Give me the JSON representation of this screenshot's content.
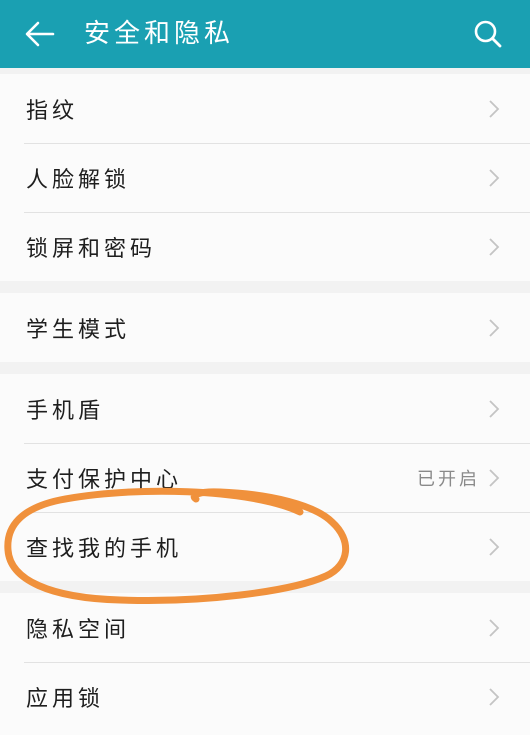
{
  "header": {
    "title": "安全和隐私",
    "back_icon": "arrow-left-icon",
    "search_icon": "search-icon",
    "bar_color": "#1aa0b2"
  },
  "groups": [
    {
      "items": [
        {
          "label": "指纹"
        },
        {
          "label": "人脸解锁"
        },
        {
          "label": "锁屏和密码"
        }
      ]
    },
    {
      "items": [
        {
          "label": "学生模式"
        }
      ]
    },
    {
      "items": [
        {
          "label": "手机盾"
        },
        {
          "label": "支付保护中心",
          "status": "已开启"
        },
        {
          "label": "查找我的手机"
        }
      ]
    },
    {
      "items": [
        {
          "label": "隐私空间"
        },
        {
          "label": "应用锁"
        }
      ]
    }
  ],
  "annotation": {
    "target": "查找我的手机",
    "color": "#f0913c"
  }
}
